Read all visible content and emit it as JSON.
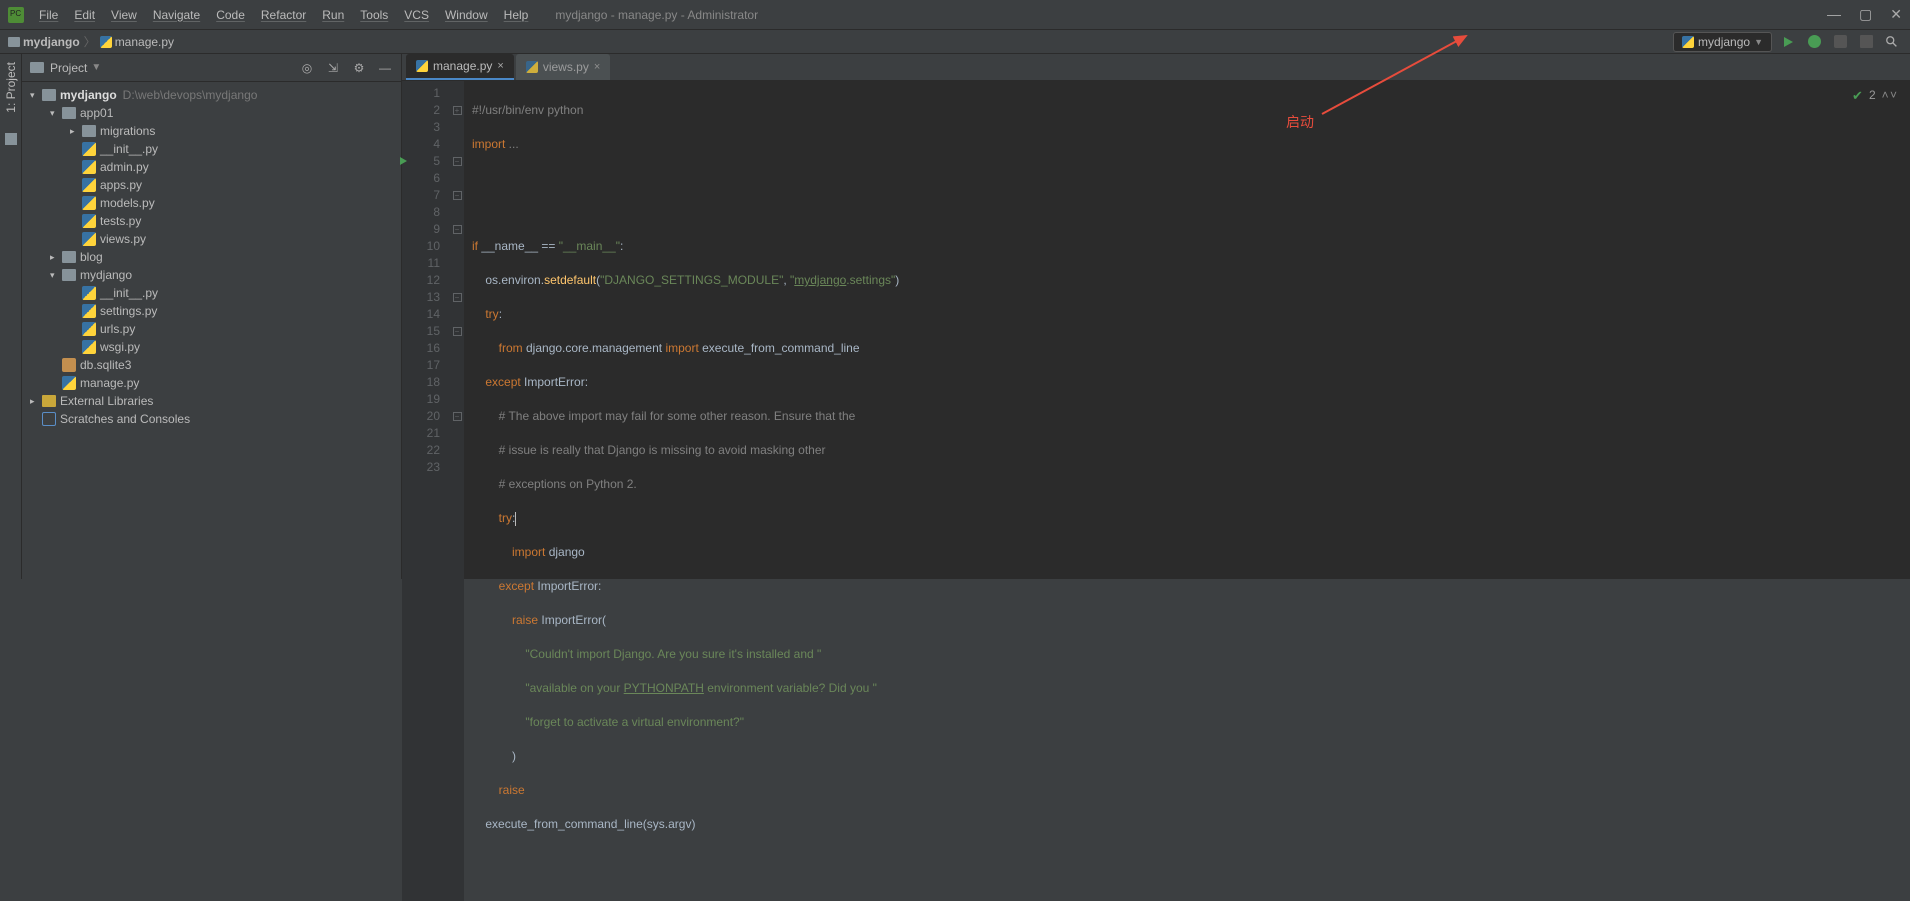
{
  "window": {
    "title": "mydjango - manage.py - Administrator",
    "menus": [
      "File",
      "Edit",
      "View",
      "Navigate",
      "Code",
      "Refactor",
      "Run",
      "Tools",
      "VCS",
      "Window",
      "Help"
    ]
  },
  "breadcrumb": {
    "root": "mydjango",
    "file": "manage.py"
  },
  "run_config": {
    "name": "mydjango"
  },
  "panel": {
    "title": "Project"
  },
  "tree": {
    "root": {
      "name": "mydjango",
      "path": "D:\\web\\devops\\mydjango"
    },
    "app01": "app01",
    "migrations": "migrations",
    "files_app01": [
      "__init__.py",
      "admin.py",
      "apps.py",
      "models.py",
      "tests.py",
      "views.py"
    ],
    "blog": "blog",
    "mydjango_pkg": "mydjango",
    "files_mydjango": [
      "__init__.py",
      "settings.py",
      "urls.py",
      "wsgi.py"
    ],
    "db": "db.sqlite3",
    "manage": "manage.py",
    "ext_lib": "External Libraries",
    "scratches": "Scratches and Consoles"
  },
  "tabs": {
    "active": "manage.py",
    "inactive": "views.py"
  },
  "code": {
    "line1_comment": "#!/usr/bin/env python",
    "line2_import": "import",
    "line2_dots": " ...",
    "line5_if": "if",
    "line5_name": " __name__ ",
    "line5_eq": "== ",
    "line5_main": "\"__main__\"",
    "line5_colon": ":",
    "line6_os": "os",
    "line6_environ": ".environ.",
    "line6_setdefault": "setdefault",
    "line6_paren": "(",
    "line6_str1": "\"DJANGO_SETTINGS_MODULE\"",
    "line6_comma": ", ",
    "line6_str2a": "\"",
    "line6_str2b": "mydjango",
    "line6_str2c": ".settings\"",
    "line6_close": ")",
    "line7_try": "try",
    "line7_colon": ":",
    "line8_from": "from",
    "line8_mod": " django.core.management ",
    "line8_import": "import",
    "line8_name": " execute_from_command_line",
    "line9_except": "except",
    "line9_err": " ImportError",
    "line9_colon": ":",
    "line10_c": "# The above import may fail for some other reason. Ensure that the",
    "line11_c": "# issue is really that Django is missing to avoid masking other",
    "line12_c": "# exceptions on Python 2.",
    "line13_try": "try",
    "line13_colon": ":",
    "line14_import": "import",
    "line14_django": " django",
    "line15_except": "except",
    "line15_err": " ImportError",
    "line15_colon": ":",
    "line16_raise": "raise",
    "line16_err": " ImportError",
    "line16_paren": "(",
    "line17_str": "\"Couldn't import Django. Are you sure it's installed and \"",
    "line18_str_a": "\"available on your ",
    "line18_str_b": "PYTHONPATH",
    "line18_str_c": " environment variable? Did you \"",
    "line19_str": "\"forget to activate a virtual environment?\"",
    "line20_close": ")",
    "line21_raise": "raise",
    "line22_call": "execute_from_command_line",
    "line22_paren": "(sys.argv)"
  },
  "line_numbers": [
    "1",
    "2",
    "3",
    "4",
    "5",
    "6",
    "7",
    "8",
    "9",
    "10",
    "11",
    "12",
    "13",
    "14",
    "15",
    "16",
    "17",
    "18",
    "19",
    "20",
    "21",
    "22",
    "23"
  ],
  "inspection": {
    "warnings": "2"
  },
  "annotation": {
    "label": "启动"
  },
  "sidebar": {
    "project_tab": "1: Project"
  }
}
